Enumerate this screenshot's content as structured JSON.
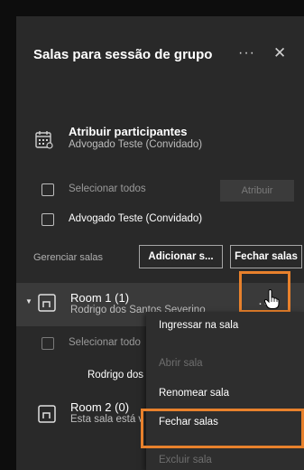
{
  "header": {
    "title": "Salas para sessão de grupo",
    "more_icon": "more-horizontal-icon",
    "close_icon": "close-icon"
  },
  "assign": {
    "title": "Atribuir participantes",
    "subtitle": "Advogado Teste (Convidado)",
    "select_all": "Selecionar todos",
    "assign_button": "Atribuir",
    "participant": "Advogado Teste (Convidado)"
  },
  "manage": {
    "label": "Gerenciar salas",
    "add_button": "Adicionar s...",
    "close_button": "Fechar salas"
  },
  "rooms": [
    {
      "title": "Room 1 (1)",
      "subtitle": "Rodrigo dos Santos Severino",
      "select_all": "Selecionar todo",
      "member": "Rodrigo dos Sa"
    },
    {
      "title": "Room 2 (0)",
      "subtitle": "Esta sala está v"
    }
  ],
  "context_menu": {
    "items": [
      {
        "label": "Ingressar na sala",
        "enabled": true
      },
      {
        "label": "Abrir sala",
        "enabled": false
      },
      {
        "label": "Renomear sala",
        "enabled": true
      },
      {
        "label": "Fechar salas",
        "enabled": true,
        "highlighted": true
      },
      {
        "label": "Excluir sala",
        "enabled": false
      }
    ]
  },
  "colors": {
    "panel_bg": "#292929",
    "highlight": "#e8812c",
    "page_bg": "#0d0d0d"
  }
}
